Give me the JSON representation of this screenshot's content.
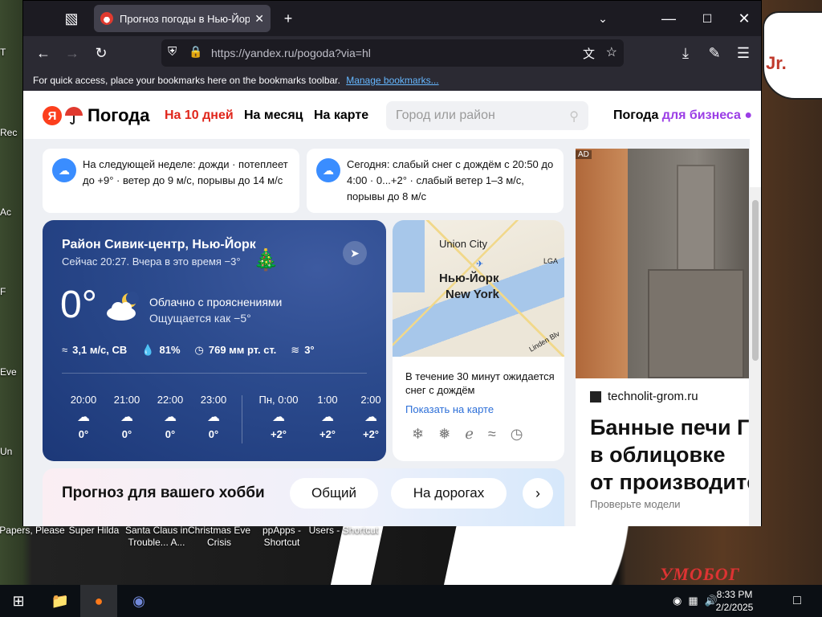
{
  "desktop": {
    "right_art_text": "Jr.",
    "corner_text": "УМОБОГ",
    "icons": [
      {
        "label": "Papers, Please"
      },
      {
        "label": "Super Hilda"
      },
      {
        "label": "Santa Claus in Trouble... A..."
      },
      {
        "label": "Christmas Eve Crisis"
      },
      {
        "label": "ppApps - Shortcut"
      },
      {
        "label": "Users - Shortcut"
      }
    ],
    "edge_labels": [
      "T",
      "Rec",
      "Ac",
      "F",
      "Eve",
      "Un"
    ]
  },
  "browser": {
    "tab_title": "Прогноз погоды в Нью-Йорке",
    "url": "https://yandex.ru/pogoda?via=hl",
    "bookmarks_hint": "For quick access, place your bookmarks here on the bookmarks toolbar.",
    "bookmarks_link": "Manage bookmarks..."
  },
  "site": {
    "logo_ya": "Я",
    "logo_text": "Погода",
    "nav": [
      "На 10 дней",
      "На месяц",
      "На карте"
    ],
    "search_placeholder": "Город или район",
    "business_prefix": "Погода ",
    "business_colored": "для бизнеса"
  },
  "alerts": [
    {
      "text": "На следующей неделе: дожди · потеплеет до +9° · ветер до 9 м/с, порывы до 14 м/с"
    },
    {
      "text": "Сегодня: слабый снег с дождём с 20:50 до 4:00 · 0...+2° · слабый ветер 1–3 м/с, порывы до 8 м/с"
    }
  ],
  "current": {
    "location": "Район Сивик-центр, Нью-Йорк",
    "now_line": "Сейчас 20:27. Вчера в это время −3°",
    "temp": "0°",
    "condition": "Облачно с прояснениями",
    "feels": "Ощущается как −5°",
    "wind": "3,1 м/с, СВ",
    "humidity": "81%",
    "pressure": "769 мм рт. ст.",
    "water": "3°"
  },
  "hourly": [
    {
      "time": "20:00",
      "temp": "0°",
      "icon": "night-cloud-icon"
    },
    {
      "time": "21:00",
      "temp": "0°",
      "icon": "snow-rain-icon"
    },
    {
      "time": "22:00",
      "temp": "0°",
      "icon": "snow-rain-icon"
    },
    {
      "time": "23:00",
      "temp": "0°",
      "icon": "snow-rain-icon"
    },
    {
      "time": "Пн, 0:00",
      "temp": "+2°",
      "icon": "night-snow-icon"
    },
    {
      "time": "1:00",
      "temp": "+2°",
      "icon": "snow-rain-icon"
    },
    {
      "time": "2:00",
      "temp": "+2°",
      "icon": "night-snow-icon"
    }
  ],
  "map": {
    "labels": [
      "Union City",
      "Нью-Йорк",
      "New York",
      "LGA",
      "Linden Blv"
    ],
    "note": "В течение 30 минут ожидается снег с дождём",
    "link": "Показать на карте"
  },
  "hobby": {
    "title": "Прогноз для вашего хобби",
    "pills": [
      "Общий",
      "На дорогах"
    ]
  },
  "ad": {
    "tag": "AD",
    "site": "technolit-grom.ru",
    "headline": [
      "Банные печи Г",
      "в облицовке",
      "от производите"
    ],
    "cut_line": "Проверьте модели"
  },
  "taskbar": {
    "time": "8:33 PM",
    "date": "2/2/2025"
  }
}
